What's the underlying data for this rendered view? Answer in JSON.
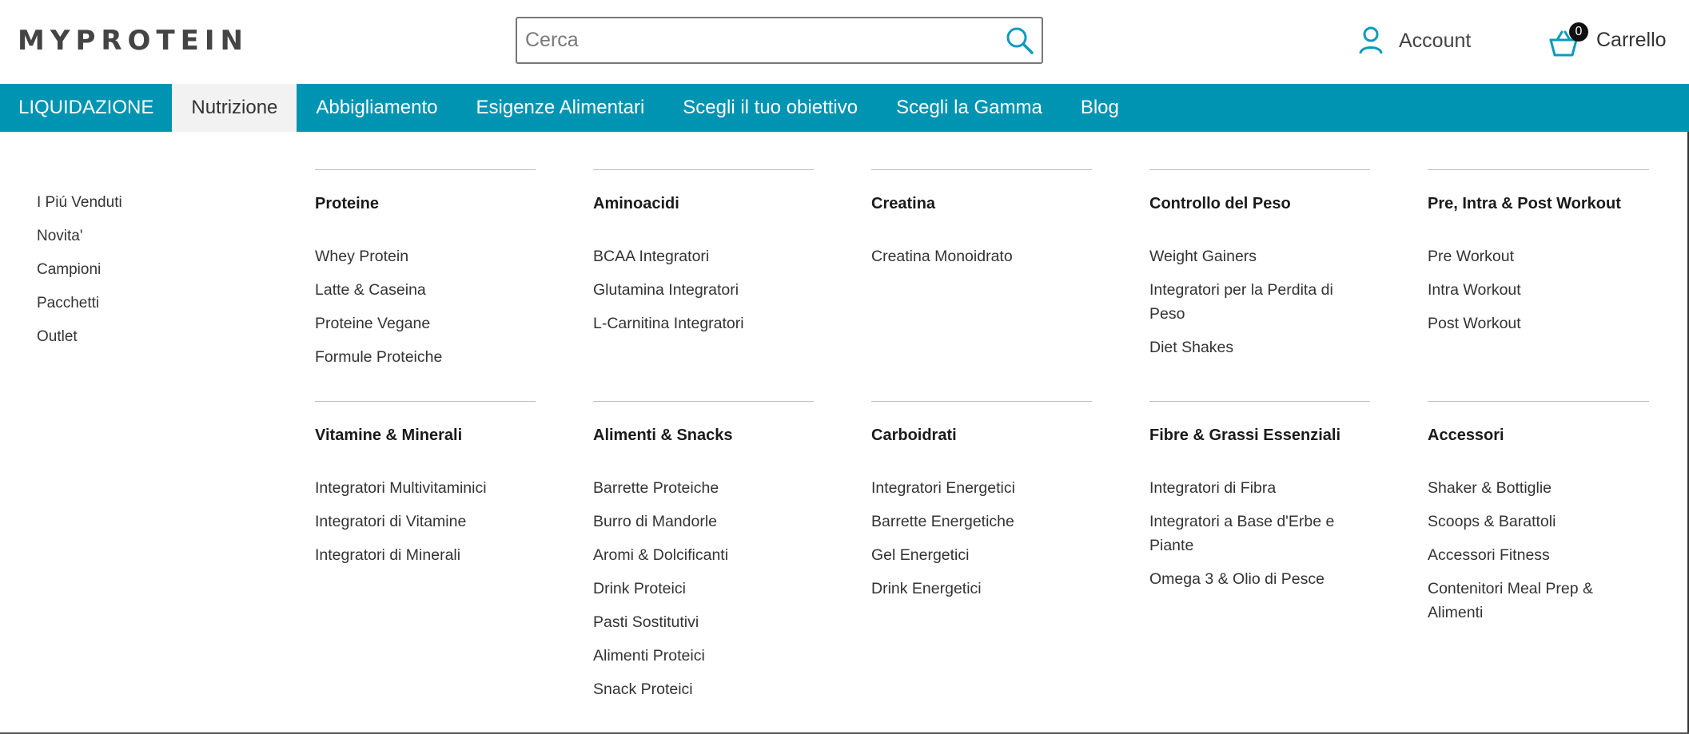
{
  "header": {
    "logo_text": "MYPROTEIN",
    "search": {
      "placeholder": "Cerca",
      "value": ""
    },
    "account_label": "Account",
    "cart_label": "Carrello",
    "cart_count": "0"
  },
  "nav": {
    "items": [
      {
        "label": "LIQUIDAZIONE"
      },
      {
        "label": "Nutrizione"
      },
      {
        "label": "Abbigliamento"
      },
      {
        "label": "Esigenze Alimentari"
      },
      {
        "label": "Scegli il tuo obiettivo"
      },
      {
        "label": "Scegli la Gamma"
      },
      {
        "label": "Blog"
      }
    ]
  },
  "menu": {
    "quick_links": [
      "I Piú Venduti",
      "Novita'",
      "Campioni",
      "Pacchetti",
      "Outlet"
    ],
    "columns": [
      {
        "title": "Proteine",
        "links": [
          "Whey Protein",
          "Latte & Caseina",
          "Proteine Vegane",
          "Formule Proteiche"
        ]
      },
      {
        "title": "Aminoacidi",
        "links": [
          "BCAA Integratori",
          "Glutamina Integratori",
          "L-Carnitina Integratori"
        ]
      },
      {
        "title": "Creatina",
        "links": [
          "Creatina Monoidrato"
        ]
      },
      {
        "title": "Controllo del Peso",
        "links": [
          "Weight Gainers",
          "Integratori per la Perdita di Peso",
          "Diet Shakes"
        ]
      },
      {
        "title": "Pre, Intra & Post Workout",
        "links": [
          "Pre Workout",
          "Intra Workout",
          "Post Workout"
        ]
      },
      {
        "title": "Vitamine & Minerali",
        "links": [
          "Integratori Multivitaminici",
          "Integratori di Vitamine",
          "Integratori di Minerali"
        ]
      },
      {
        "title": "Alimenti & Snacks",
        "links": [
          "Barrette Proteiche",
          "Burro di Mandorle",
          "Aromi & Dolcificanti",
          "Drink Proteici",
          "Pasti Sostitutivi",
          "Alimenti Proteici",
          "Snack Proteici"
        ]
      },
      {
        "title": "Carboidrati",
        "links": [
          "Integratori Energetici",
          "Barrette Energetiche",
          "Gel Energetici",
          "Drink Energetici"
        ]
      },
      {
        "title": "Fibre & Grassi Essenziali",
        "links": [
          "Integratori di Fibra",
          "Integratori a Base d'Erbe e Piante",
          "Omega 3 & Olio di Pesce"
        ]
      },
      {
        "title": "Accessori",
        "links": [
          "Shaker & Bottiglie",
          "Scoops & Barattoli",
          "Accessori Fitness",
          "Contenitori Meal Prep & Alimenti"
        ]
      }
    ]
  },
  "colors": {
    "nav_bg": "#0094b3",
    "accent_icon": "#0a9bbd"
  },
  "icons": {
    "search": "search-icon",
    "account": "user-icon",
    "cart": "basket-icon"
  }
}
